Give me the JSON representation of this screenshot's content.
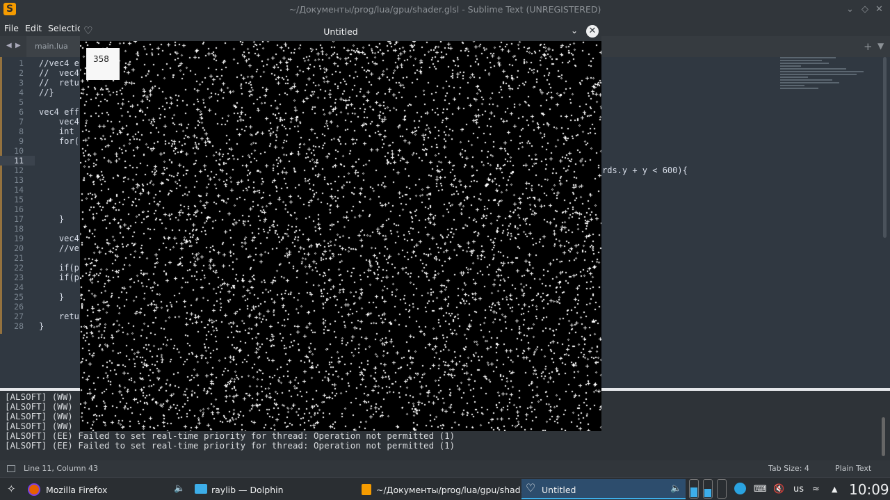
{
  "sublime": {
    "title": "~/Документы/prog/lua/gpu/shader.glsl - Sublime Text (UNREGISTERED)",
    "title_buttons": [
      "chevron-down-icon",
      "diamond-icon",
      "close-icon"
    ],
    "menu": [
      "File",
      "Edit",
      "Selectio"
    ],
    "tab_label": "main.lua",
    "line_numbers": [
      "1",
      "2",
      "3",
      "4",
      "5",
      "6",
      "7",
      "8",
      "9",
      "10",
      "11",
      "12",
      "13",
      "14",
      "15",
      "16",
      "17",
      "18",
      "19",
      "20",
      "21",
      "22",
      "23",
      "24",
      "25",
      "26",
      "27",
      "28"
    ],
    "active_line": "11",
    "code_lines": [
      "//vec4 e",
      "//  vec4",
      "//  retu",
      "//}",
      "",
      "vec4 eff",
      "    vec4",
      "    int ",
      "    for(",
      "",
      "",
      "",
      "",
      "",
      "",
      "",
      "    }",
      "",
      "    vec4",
      "    //ve",
      "",
      "    if(p",
      "    if(p",
      "",
      "    }",
      "",
      "    retu",
      "}"
    ],
    "code_fragment": "rds.y + y < 600){",
    "console_lines": [
      "[ALSOFT] (WW) ",
      "[ALSOFT] (WW) ",
      "[ALSOFT] (WW) ",
      "[ALSOFT] (WW) ",
      "[ALSOFT] (EE) Failed to set real-time priority for thread: Operation not permitted (1)",
      "[ALSOFT] (EE) Failed to set real-time priority for thread: Operation not permitted (1)"
    ],
    "status": {
      "position": "Line 11, Column 43",
      "tab_size": "Tab Size: 4",
      "syntax": "Plain Text"
    }
  },
  "game_window": {
    "title": "Untitled",
    "fps": "358"
  },
  "taskbar": {
    "tasks": [
      {
        "label": "Mozilla Firefox",
        "icon": "firefox-icon"
      },
      {
        "label": "raylib — Dolphin",
        "icon": "folder-icon"
      },
      {
        "label": "~/Документы/prog/lua/gpu/shad...",
        "icon": "sublime-icon"
      },
      {
        "label": "Untitled",
        "icon": "heart-icon"
      }
    ],
    "keyboard_layout": "us",
    "clock": "10:09"
  },
  "colors": {
    "accent": "#3daee9",
    "sublime_logo": "#f59b00",
    "editor_bg": "#303841"
  }
}
